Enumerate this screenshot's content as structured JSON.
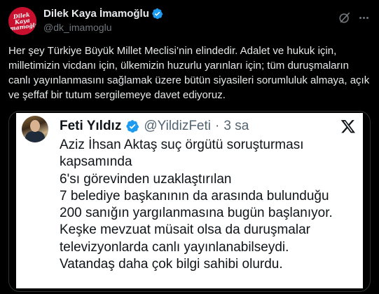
{
  "author": {
    "display_name": "Dilek Kaya İmamoğlu",
    "handle": "@dk_imamoglu",
    "avatar_text": "Dilek Kaya İmamoğlu"
  },
  "post": {
    "text": "Her şey Türkiye Büyük Millet Meclisi’nin elindedir. Adalet ve hukuk için, milletimizin vicdanı için, ülkemizin huzurlu yarınları için; tüm duruşmaların canlı yayınlanmasını sağlamak üzere bütün siyasileri sorumluluk almaya, açık ve şeffaf bir tutum sergilemeye davet ediyoruz."
  },
  "quoted": {
    "name": "Feti Yıldız",
    "handle": "@YildizFeti",
    "separator": "·",
    "time": "3 sa",
    "text": "Aziz İhsan Aktaş suç örgütü soruşturması kapsamında\n 6'sı görevinden uzaklaştırılan\n7 belediye başkanının da arasında bulunduğu\n200 sanığın yargılanmasına bugün başlanıyor.\nKeşke mevzuat müsait olsa da duruşmalar\ntelevizyonlarda canlı yayınlanabilseydi.\nVatandaş daha çok bilgi sahibi olurdu."
  },
  "icons": {
    "verified": "verified-badge-icon",
    "grok": "grok-icon",
    "more": "more-icon",
    "x_logo": "x-logo-icon"
  },
  "colors": {
    "background": "#000000",
    "text": "#e7e9ea",
    "secondary": "#71767b",
    "verified": "#1d9bf0",
    "avatar_bg": "#c8102e"
  }
}
